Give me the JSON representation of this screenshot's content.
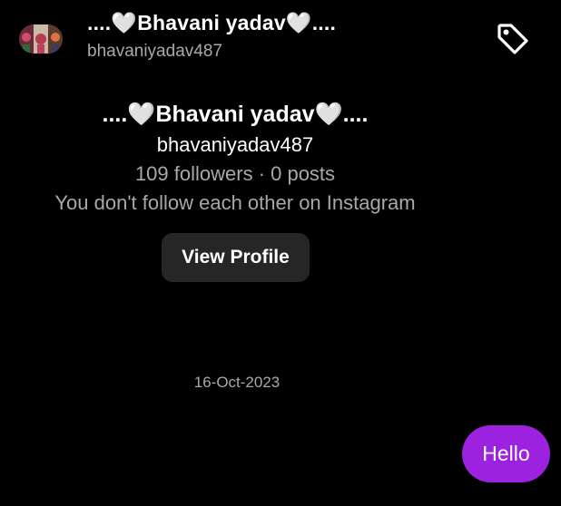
{
  "header": {
    "name": "....🤍Bhavani yadav🤍....",
    "username": "bhavaniyadav487",
    "avatar_icon": "avatar-image",
    "tag_icon": "tag-icon"
  },
  "profile": {
    "name": "....🤍Bhavani yadav🤍....",
    "username": "bhavaniyadav487",
    "stats": "109 followers · 0 posts",
    "mutual": "You don't follow each other on Instagram",
    "view_profile_label": "View Profile"
  },
  "conversation": {
    "date": "16-Oct-2023",
    "messages": [
      {
        "text": "Hello",
        "sender": "me"
      }
    ]
  },
  "colors": {
    "background": "#000000",
    "secondary_text": "#a8a8a8",
    "button_bg": "#262626",
    "bubble_bg": "#9d22e0"
  }
}
